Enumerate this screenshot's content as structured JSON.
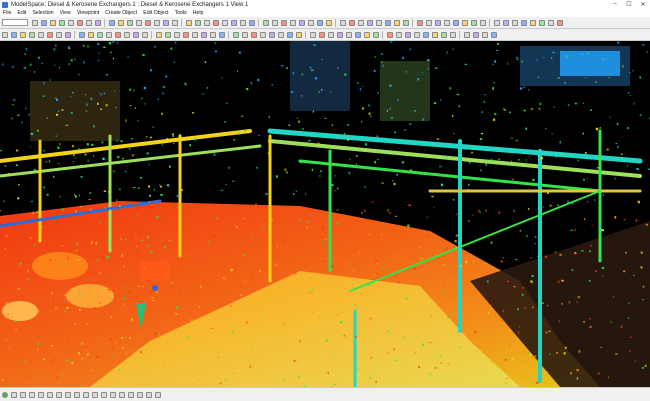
{
  "window": {
    "title": "ModelSpace: Diesel & Kerosene Exchangers 1 : Diesel & Kerosene Exchangers 1 View 1",
    "controls": [
      "–",
      "☐",
      "✕"
    ]
  },
  "menu": [
    "File",
    "Edit",
    "Selection",
    "View",
    "Viewpoint",
    "Create Object",
    "Edit Object",
    "Tools",
    "Help"
  ],
  "toolbar": {
    "row1_count": 62,
    "row2_count": 58,
    "field_value": ""
  },
  "statusbar": {
    "count": 18
  },
  "colors": {
    "background": "#000000",
    "ground_hot": "#ff3a12",
    "ground_warm": "#ff9a1a",
    "ground_mid": "#f2d21a",
    "structure_green": "#34e34a",
    "structure_cyan": "#22d6c6",
    "highlight_blue": "#22a6ff"
  }
}
